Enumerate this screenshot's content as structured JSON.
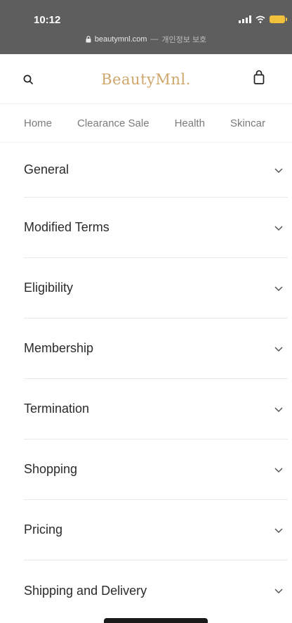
{
  "status": {
    "time": "10:12"
  },
  "browser": {
    "url": "beautymnl.com",
    "separator": "—",
    "privacy_text": "개인정보 보호"
  },
  "header": {
    "brand": "BeautyMnl."
  },
  "nav": [
    "Home",
    "Clearance Sale",
    "Health",
    "Skincar"
  ],
  "sections": [
    "General",
    "Modified Terms",
    "Eligibility",
    "Membership",
    "Termination",
    "Shopping",
    "Pricing",
    "Shipping and Delivery"
  ],
  "colors": {
    "brand": "#cfa66a",
    "status_bar": "#5e5e5e",
    "battery": "#f2c13b"
  }
}
